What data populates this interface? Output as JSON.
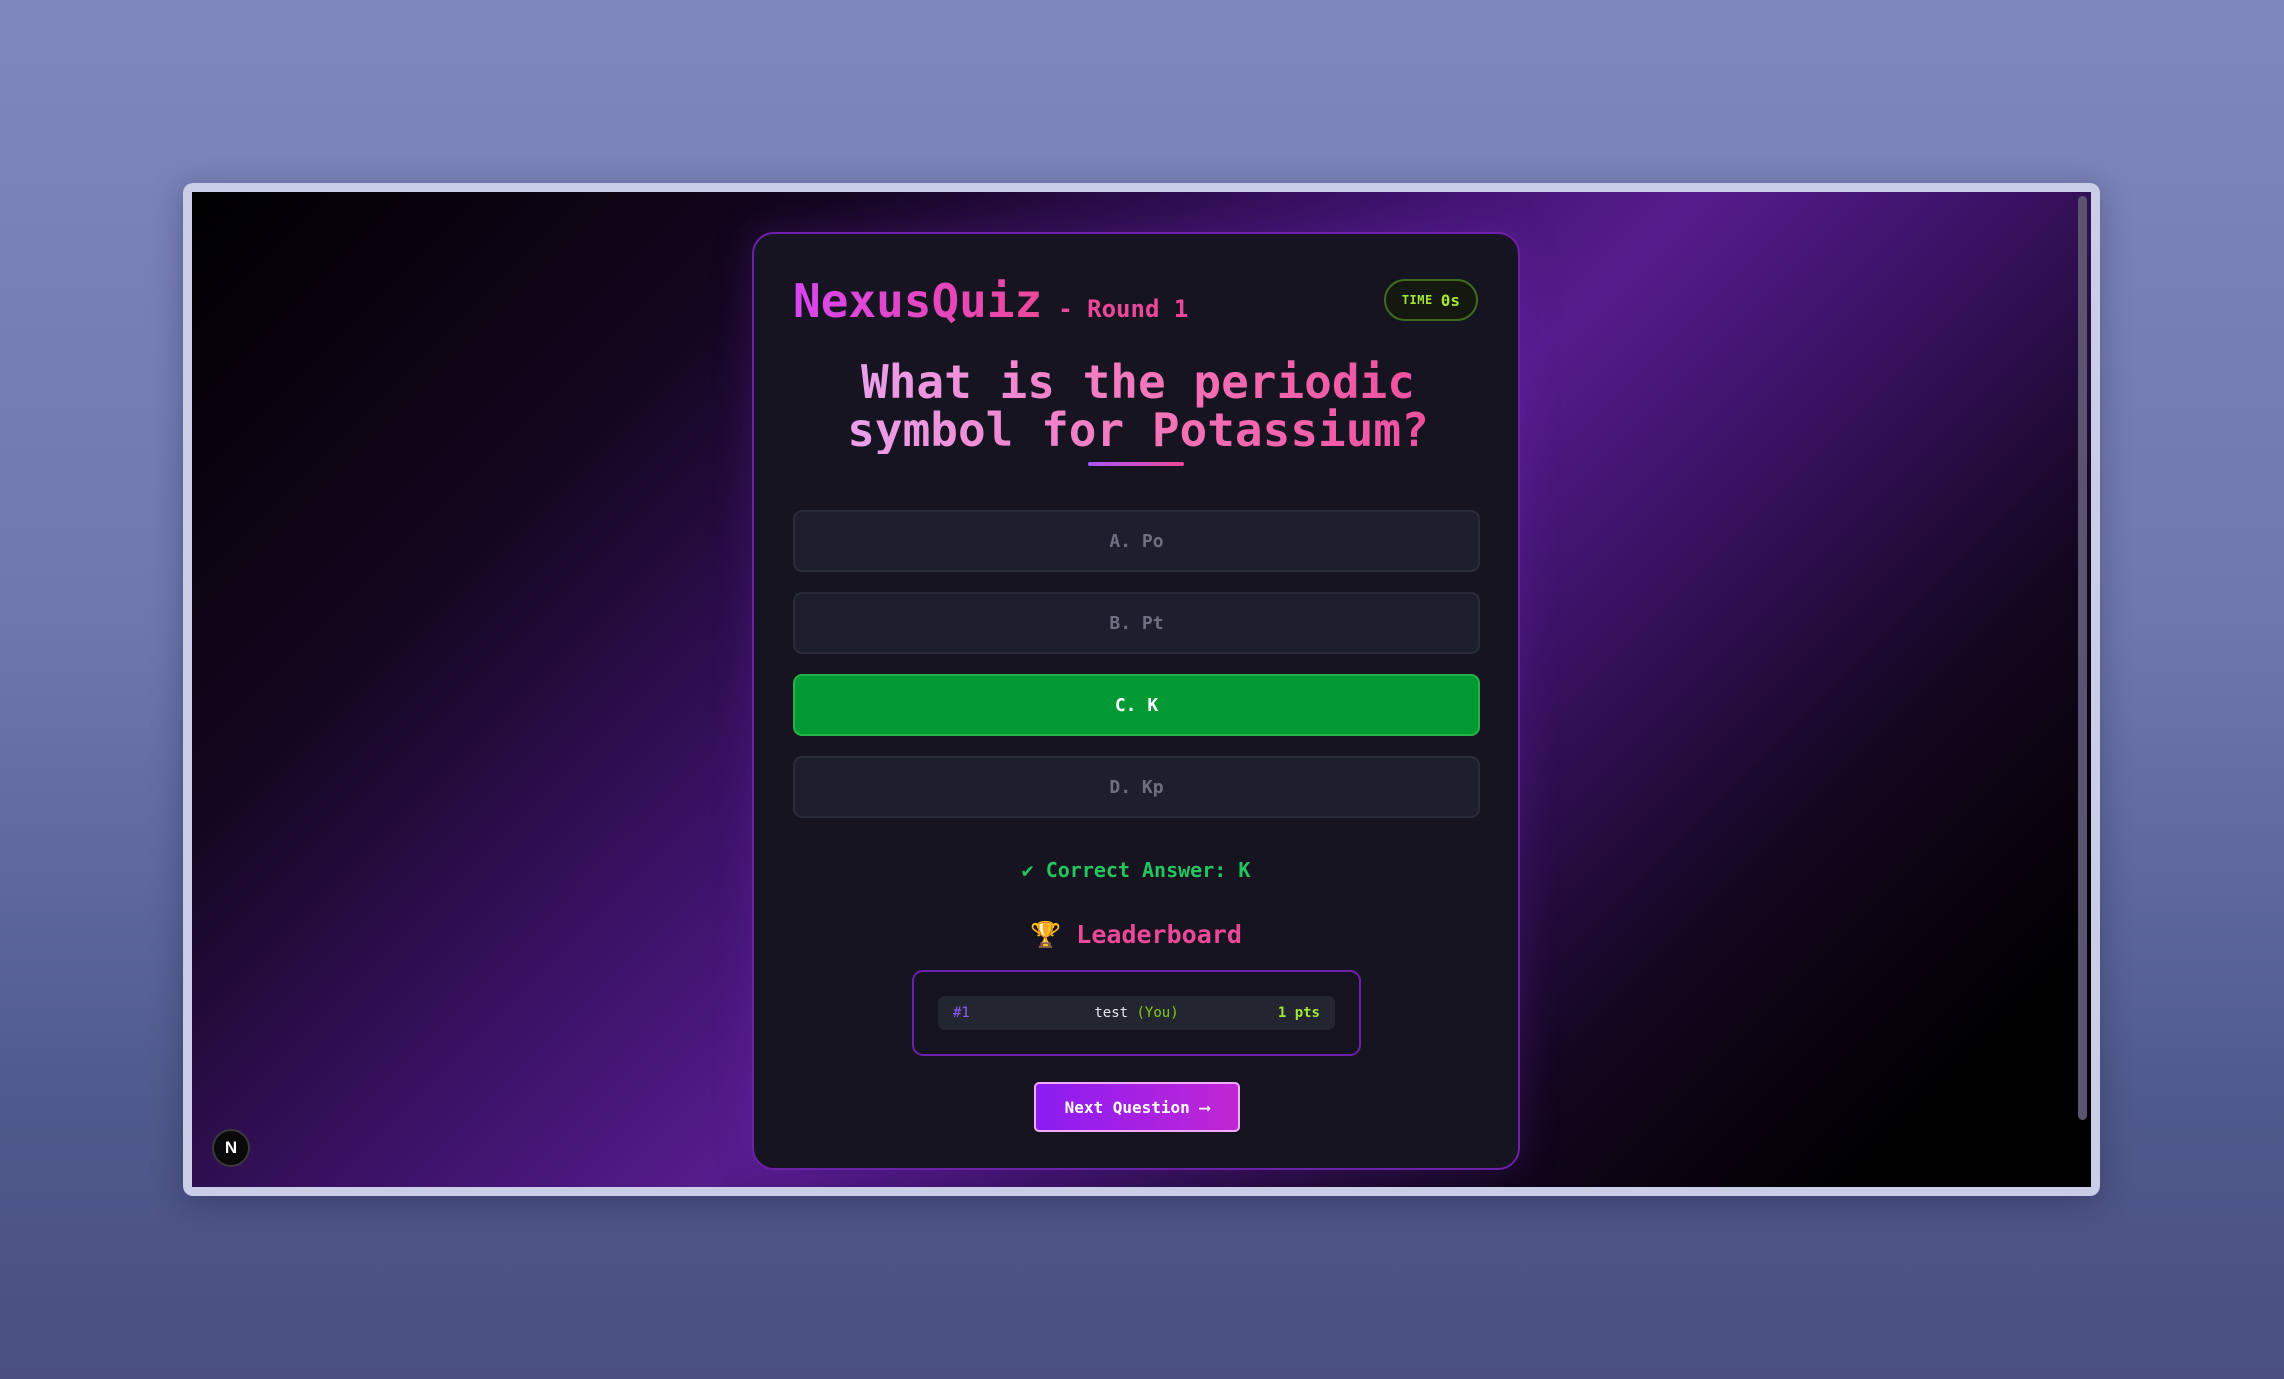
{
  "app": {
    "brand": "NexusQuiz",
    "round_label": "- Round 1",
    "timer_label": "TIME",
    "timer_value": "0s"
  },
  "question": {
    "text": "What is the periodic symbol for Potassium?"
  },
  "options": [
    {
      "label": "A. Po",
      "state": "dimmed"
    },
    {
      "label": "B. Pt",
      "state": "dimmed"
    },
    {
      "label": "C. K",
      "state": "correct"
    },
    {
      "label": "D. Kp",
      "state": "dimmed"
    }
  ],
  "result": {
    "message": "✔ Correct Answer: K"
  },
  "leaderboard": {
    "title": "🏆 Leaderboard",
    "rows": [
      {
        "rank": "#1",
        "name": "test",
        "you_tag": "(You)",
        "points": "1 pts"
      }
    ]
  },
  "actions": {
    "next_label": "Next Question",
    "next_arrow": "⟶"
  },
  "badge": {
    "next_logo": "N"
  },
  "colors": {
    "accent": "#d946ef",
    "pink": "#ec4899",
    "correct": "#019934",
    "lime": "#a3e635"
  }
}
